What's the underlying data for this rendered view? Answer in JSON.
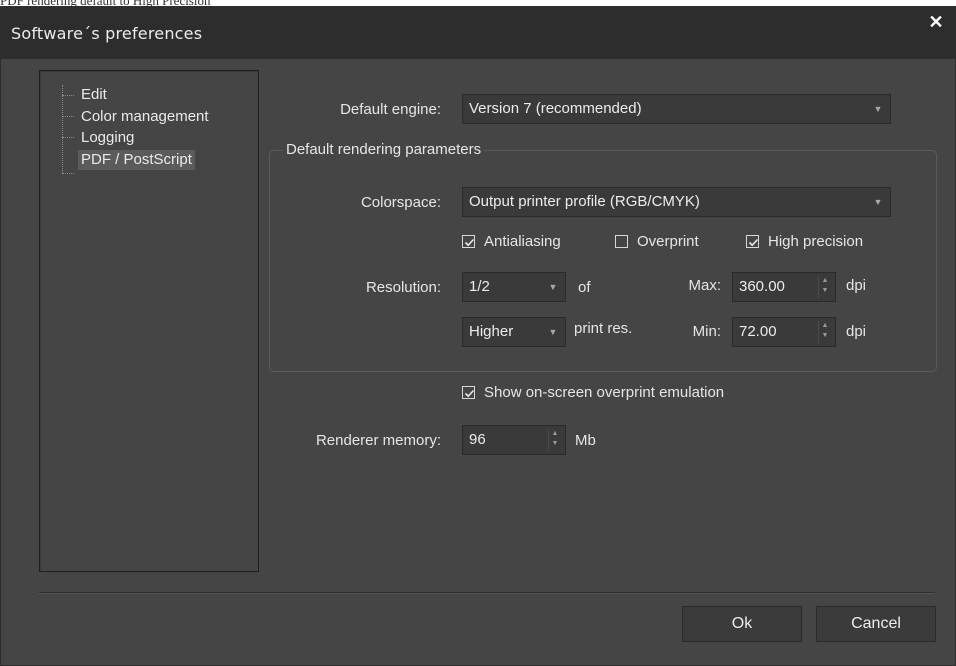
{
  "caption": "PDF rendering default to High Precision",
  "window": {
    "title": "Software´s preferences"
  },
  "tree": {
    "items": [
      {
        "label": "Edit",
        "selected": false
      },
      {
        "label": "Color management",
        "selected": false
      },
      {
        "label": "Logging",
        "selected": false
      },
      {
        "label": "PDF / PostScript",
        "selected": true
      }
    ]
  },
  "engine": {
    "label": "Default engine:",
    "value": "Version 7 (recommended)"
  },
  "rendering": {
    "group_title": "Default rendering parameters",
    "colorspace_label": "Colorspace:",
    "colorspace_value": "Output printer profile (RGB/CMYK)",
    "antialiasing": {
      "label": "Antialiasing",
      "checked": true
    },
    "overprint": {
      "label": "Overprint",
      "checked": false
    },
    "high_precision": {
      "label": "High precision",
      "checked": true
    },
    "resolution_label": "Resolution:",
    "resolution_value": "1/2",
    "of_label": "of",
    "print_res_value": "Higher",
    "print_res_label": "print res.",
    "max_label": "Max:",
    "max_value": "360.00",
    "min_label": "Min:",
    "min_value": "72.00",
    "dpi_unit": "dpi"
  },
  "overprint_emulation": {
    "label": "Show on-screen overprint emulation",
    "checked": true
  },
  "memory": {
    "label": "Renderer memory:",
    "value": "96",
    "unit": "Mb"
  },
  "buttons": {
    "ok": "Ok",
    "cancel": "Cancel"
  },
  "colors": {
    "window_bg": "#454545",
    "titlebar_bg": "#2d2d2d",
    "selection_bg": "#5b5b5b"
  }
}
